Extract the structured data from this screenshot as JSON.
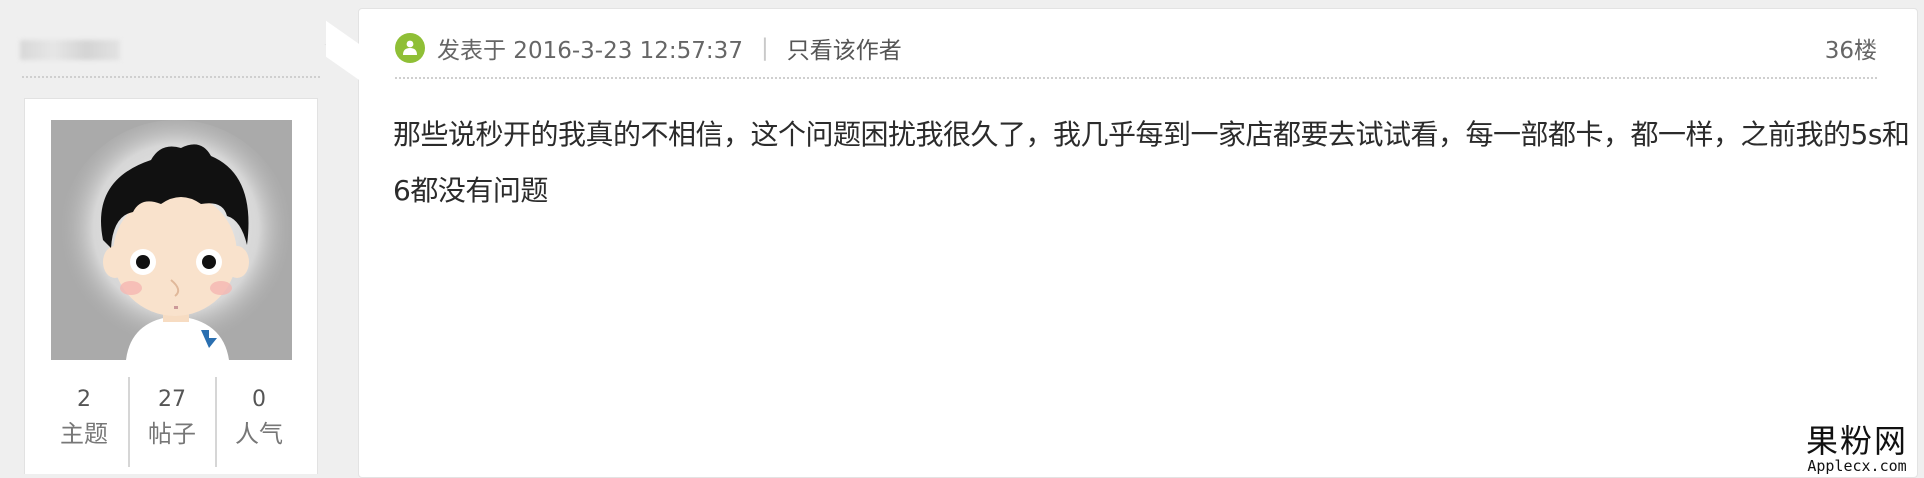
{
  "user": {
    "stats": [
      {
        "value": "2",
        "label": "主题"
      },
      {
        "value": "27",
        "label": "帖子"
      },
      {
        "value": "0",
        "label": "人气"
      }
    ]
  },
  "post": {
    "posted_at": "发表于 2016-3-23 12:57:37",
    "separator": "|",
    "only_author_label": "只看该作者",
    "floor": "36楼",
    "body": "那些说秒开的我真的不相信，这个问题困扰我很久了，我几乎每到一家店都要去试试看，每一部都卡，都一样，之前我的5s和6都没有问题",
    "icon": "author-icon",
    "accent_color": "#8fbf36"
  },
  "watermark": {
    "cn": "果粉网",
    "en": "Applecx.com"
  }
}
